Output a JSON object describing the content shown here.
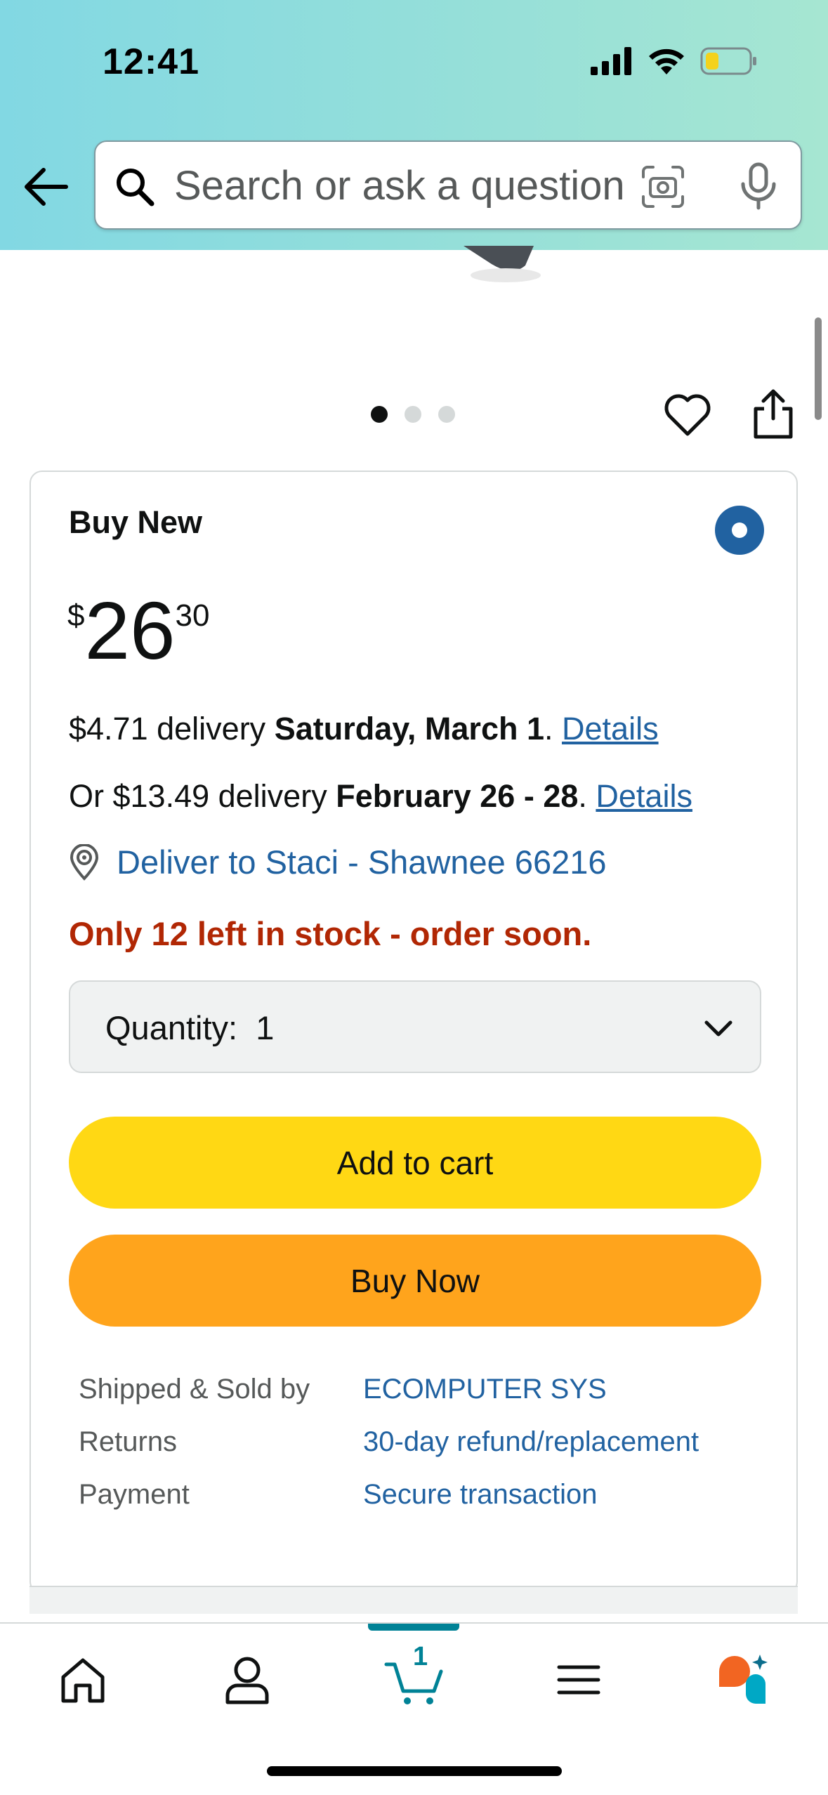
{
  "status_bar": {
    "time": "12:41"
  },
  "header": {
    "search_placeholder": "Search or ask a question"
  },
  "carousel": {
    "count": 3,
    "active_index": 0
  },
  "buy_box": {
    "title": "Buy New",
    "price": {
      "symbol": "$",
      "whole": "26",
      "fraction": "30"
    },
    "delivery_primary": {
      "prefix": "$4.71 delivery ",
      "date": "Saturday, March 1",
      "suffix": ". ",
      "link": "Details"
    },
    "delivery_secondary": {
      "prefix": "Or $13.49 delivery ",
      "date": "February 26 - 28",
      "suffix": ". ",
      "link": "Details"
    },
    "deliver_to": "Deliver to Staci - Shawnee 66216",
    "stock_message": "Only 12 left in stock - order soon.",
    "quantity": {
      "label": "Quantity:",
      "value": "1"
    },
    "add_to_cart_label": "Add to cart",
    "buy_now_label": "Buy Now",
    "details": [
      {
        "label": "Shipped & Sold by",
        "value": "ECOMPUTER SYS"
      },
      {
        "label": "Returns",
        "value": "30-day refund/replacement"
      },
      {
        "label": "Payment",
        "value": "Secure transaction"
      }
    ]
  },
  "bottom_nav": {
    "items": [
      "home-icon",
      "account-icon",
      "cart-icon",
      "menu-icon",
      "rufus-icon"
    ],
    "cart_count": "1"
  },
  "colors": {
    "link": "#2162a1",
    "stock": "#b12704",
    "add_to_cart": "#ffd814",
    "buy_now": "#ffa41c",
    "cart_accent": "#008296"
  }
}
